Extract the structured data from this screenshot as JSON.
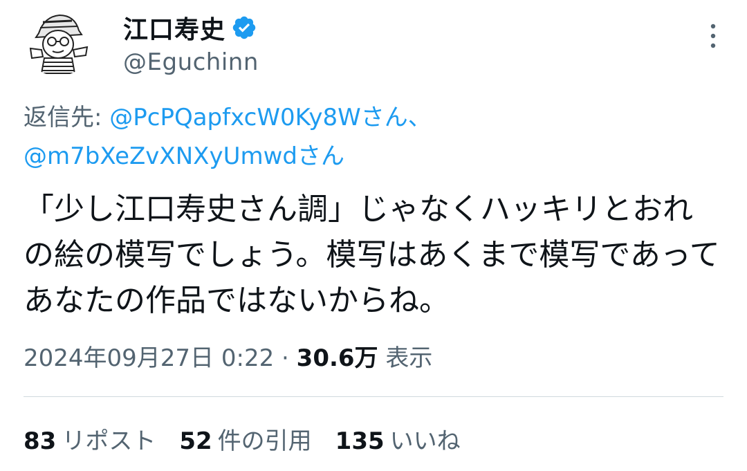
{
  "tweet": {
    "author": {
      "display_name": "江口寿史",
      "handle": "@Eguchinn",
      "verified_color": "#1d9bf0",
      "avatar": "manga-portrait-avatar"
    },
    "reply_to": {
      "prefix": "返信先: ",
      "mentions": [
        "@PcPQapfxcW0Ky8Wさん、",
        "@m7bXeZvXNXyUmwdさん"
      ]
    },
    "text": "「少し江口寿史さん調」じゃなくハッキリとおれの絵の模写でしょう。模写はあくまで模写であってあなたの作品ではないからね。",
    "timestamp": "2024年09月27日 0:22",
    "separator": " · ",
    "views_count": "30.6万",
    "views_label": "表示",
    "stats": {
      "reposts": {
        "count": "83",
        "label": "リポスト"
      },
      "quotes": {
        "count": "52",
        "label": "件の引用"
      },
      "likes": {
        "count": "135",
        "label": "いいね"
      }
    }
  },
  "colors": {
    "link": "#1d9bf0",
    "secondary_text": "#536471",
    "primary_text": "#0f1419",
    "divider": "#cfd9de"
  }
}
